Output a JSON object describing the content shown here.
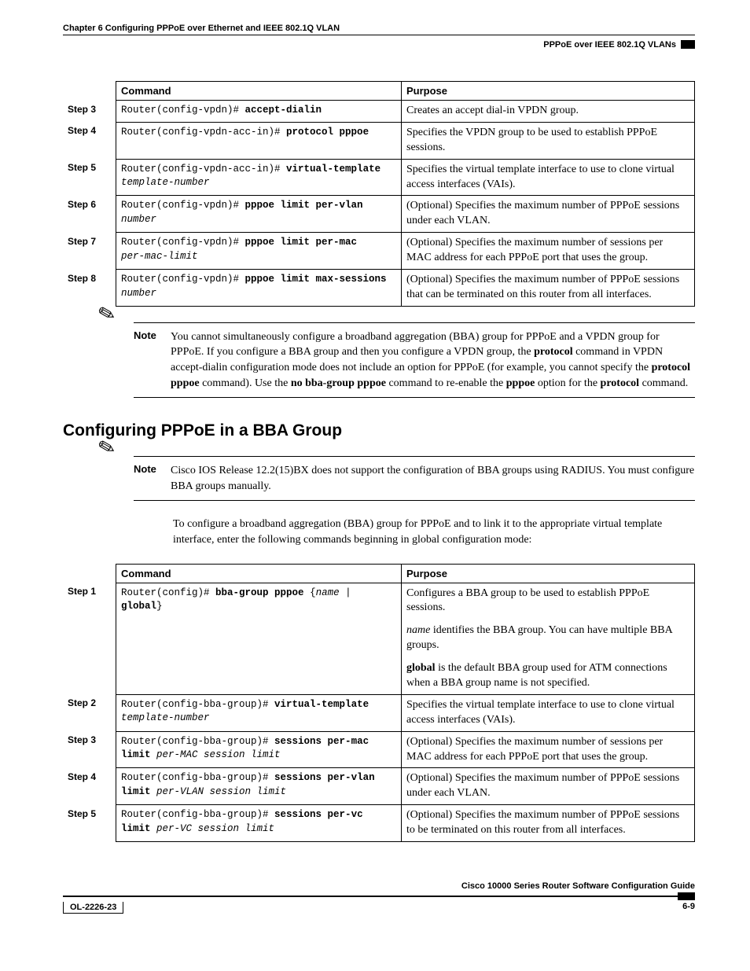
{
  "header": {
    "chapter": "Chapter 6      Configuring PPPoE over Ethernet and IEEE 802.1Q VLAN",
    "section": "PPPoE over IEEE 802.1Q VLANs"
  },
  "table1": {
    "headers": {
      "command": "Command",
      "purpose": "Purpose"
    },
    "rows": [
      {
        "step": "Step 3",
        "cmd_prefix": "Router(config-vpdn)# ",
        "cmd_bold": "accept-dialin",
        "cmd_ital": "",
        "purpose": "Creates an accept dial-in VPDN group."
      },
      {
        "step": "Step 4",
        "cmd_prefix": "Router(config-vpdn-acc-in)# ",
        "cmd_bold": "protocol pppoe",
        "cmd_ital": "",
        "purpose": "Specifies the VPDN group to be used to establish PPPoE sessions."
      },
      {
        "step": "Step 5",
        "cmd_prefix": "Router(config-vpdn-acc-in)# ",
        "cmd_bold": "virtual-template",
        "cmd_ital": "template-number",
        "purpose": "Specifies the virtual template interface to use to clone virtual access interfaces (VAIs)."
      },
      {
        "step": "Step 6",
        "cmd_prefix": "Router(config-vpdn)# ",
        "cmd_bold": "pppoe limit per-vlan",
        "cmd_ital": "number",
        "purpose": "(Optional) Specifies the maximum number of PPPoE sessions under each VLAN."
      },
      {
        "step": "Step 7",
        "cmd_prefix": "Router(config-vpdn)# ",
        "cmd_bold": "pppoe limit per-mac",
        "cmd_ital": "per-mac-limit",
        "purpose": "(Optional) Specifies the maximum number of sessions per MAC address for each PPPoE port that uses the group."
      },
      {
        "step": "Step 8",
        "cmd_prefix": "Router(config-vpdn)# ",
        "cmd_bold": "pppoe limit max-sessions",
        "cmd_ital": "number",
        "purpose": "(Optional) Specifies the maximum number of PPPoE sessions that can be terminated on this router from all interfaces."
      }
    ]
  },
  "note1": {
    "label": "Note",
    "text_parts": {
      "p1": "You cannot simultaneously configure a broadband aggregation (BBA) group for PPPoE and a VPDN group for PPPoE. If you configure a BBA group and then you configure a VPDN group, the ",
      "b1": "protocol",
      "p2": " command in VPDN accept-dialin configuration mode does not include an option for PPPoE (for example, you cannot specify the ",
      "b2": "protocol pppoe",
      "p3": " command). Use the ",
      "b3": "no bba-group pppoe",
      "p4": " command to re-enable the ",
      "b4": "pppoe",
      "p5": " option for the ",
      "b5": "protocol",
      "p6": " command."
    }
  },
  "heading2": "Configuring PPPoE in a BBA Group",
  "note2": {
    "label": "Note",
    "text": "Cisco IOS Release 12.2(15)BX does not support the configuration of BBA groups using RADIUS. You must configure BBA groups manually."
  },
  "para1": "To configure a broadband aggregation (BBA) group for PPPoE and to link it to the appropriate virtual template interface, enter the following commands beginning in global configuration mode:",
  "table2": {
    "headers": {
      "command": "Command",
      "purpose": "Purpose"
    },
    "rows": [
      {
        "step": "Step 1",
        "cmd_html": "Router(config)# <b>bba-group pppoe</b> {<i>name</i> | <b>global</b>}",
        "purpose_html": "<p>Configures a BBA group to be used to establish PPPoE sessions.</p><p><em>name</em> identifies the BBA group. You can have multiple BBA groups.</p><p><strong>global</strong> is the default BBA group used for ATM connections when a BBA group name is not specified.</p>"
      },
      {
        "step": "Step 2",
        "cmd_html": "Router(config-bba-group)# <b>virtual-template</b> <i>template-number</i>",
        "purpose_html": "Specifies the virtual template interface to use to clone virtual access interfaces (VAIs)."
      },
      {
        "step": "Step 3",
        "cmd_html": "Router(config-bba-group)# <b>sessions per-mac limit</b> <i>per-MAC session limit</i>",
        "purpose_html": "(Optional) Specifies the maximum number of sessions per MAC address for each PPPoE port that uses the group."
      },
      {
        "step": "Step 4",
        "cmd_html": "Router(config-bba-group)# <b>sessions per-vlan limit</b> <i>per-VLAN session limit</i>",
        "purpose_html": "(Optional) Specifies the maximum number of PPPoE sessions under each VLAN."
      },
      {
        "step": "Step 5",
        "cmd_html": "Router(config-bba-group)# <b>sessions per-vc limit</b> <i>per-VC session limit</i>",
        "purpose_html": "(Optional) Specifies the maximum number of PPPoE sessions to be terminated on this router from all interfaces."
      }
    ]
  },
  "footer": {
    "title": "Cisco 10000 Series Router Software Configuration Guide",
    "doc_id": "OL-2226-23",
    "page_num": "6-9"
  }
}
